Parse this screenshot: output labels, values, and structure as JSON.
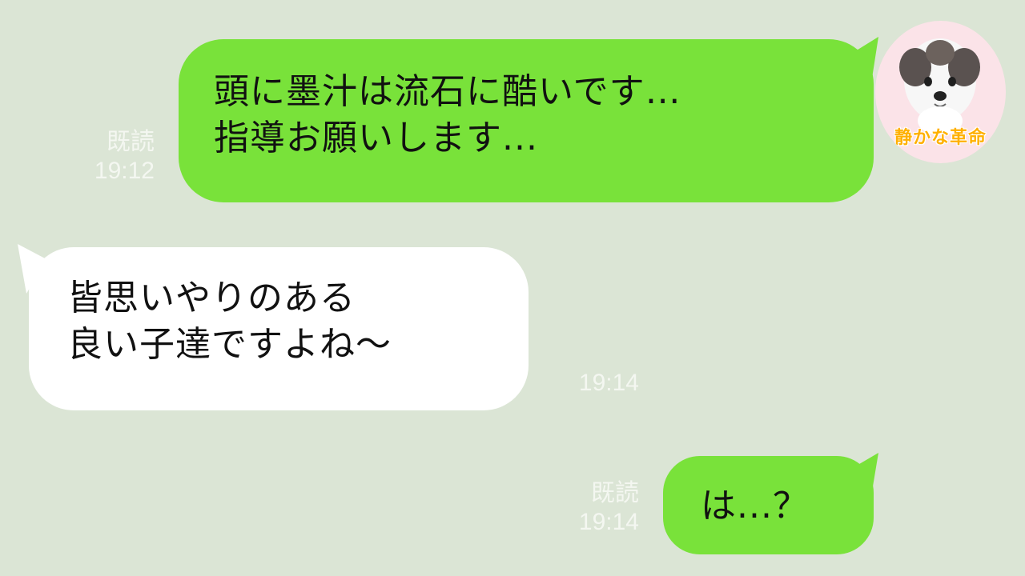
{
  "chat": {
    "messages": [
      {
        "sender": "self",
        "text": "頭に墨汁は流石に酷いです…\n指導お願いします...",
        "read_label": "既読",
        "time": "19:12"
      },
      {
        "sender": "other",
        "text": "皆思いやりのある\n良い子達ですよね〜",
        "time": "19:14"
      },
      {
        "sender": "self",
        "text": "は...？",
        "read_label": "既読",
        "time": "19:14"
      }
    ]
  },
  "avatar": {
    "label": "静かな革命",
    "icon": "dog-avatar-icon"
  },
  "colors": {
    "background": "#dbe5d5",
    "outgoing_bubble": "#79e23a",
    "incoming_bubble": "#ffffff",
    "meta_text": "#f4f7f1",
    "avatar_bg": "#fbe3e8"
  }
}
